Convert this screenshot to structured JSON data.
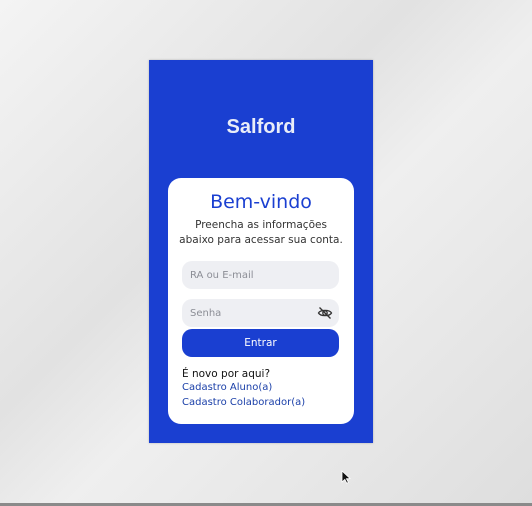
{
  "app": {
    "brand": "Salford"
  },
  "login": {
    "title": "Bem-vindo",
    "subtitle": "Preencha as informações abaixo para acessar sua conta.",
    "email_placeholder": "RA ou E-mail",
    "email_value": "",
    "password_placeholder": "Senha",
    "password_value": "",
    "password_toggle_icon": "eye-off-icon",
    "submit_label": "Entrar",
    "new_here": "É novo por aqui?",
    "links": {
      "student": "Cadastro Aluno(a)",
      "staff": "Cadastro Colaborador(a)"
    }
  },
  "colors": {
    "accent": "#1a3fd1",
    "card": "#ffffff",
    "input_bg": "#eeeff3",
    "link": "#1a3fa8"
  }
}
